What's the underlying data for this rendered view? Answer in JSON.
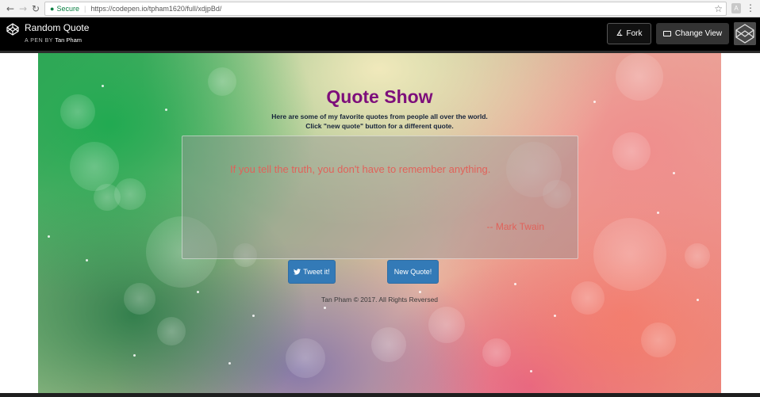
{
  "browser": {
    "secure_label": "Secure",
    "url": "https://codepen.io/tpham1620/full/xdjpBd/",
    "back_icon": "arrow-left-icon",
    "forward_icon": "arrow-right-icon",
    "reload_icon": "reload-icon",
    "lock_icon": "lock-icon",
    "star_icon": "star-icon",
    "menu_icon": "kebab-menu-icon"
  },
  "codepen": {
    "pen_title": "Random Quote",
    "byline_prefix": "A PEN BY",
    "author": "Tan Pham",
    "fork_label": "Fork",
    "change_view_label": "Change View"
  },
  "page": {
    "title": "Quote Show",
    "intro_line1": "Here are some of my favorite quotes from people all over the world.",
    "intro_line2": "Click \"new quote\" button for a different quote.",
    "quote_text": "If you tell the truth, you don't have to remember anything.",
    "quote_author": "-- Mark Twain",
    "tweet_button": "Tweet it!",
    "new_quote_button": "New Quote!",
    "footer": "Tan Pham © 2017. All Rights Reversed",
    "colors": {
      "title": "#7d0e7b",
      "quote": "#e0625a",
      "button": "#337ab7"
    }
  }
}
